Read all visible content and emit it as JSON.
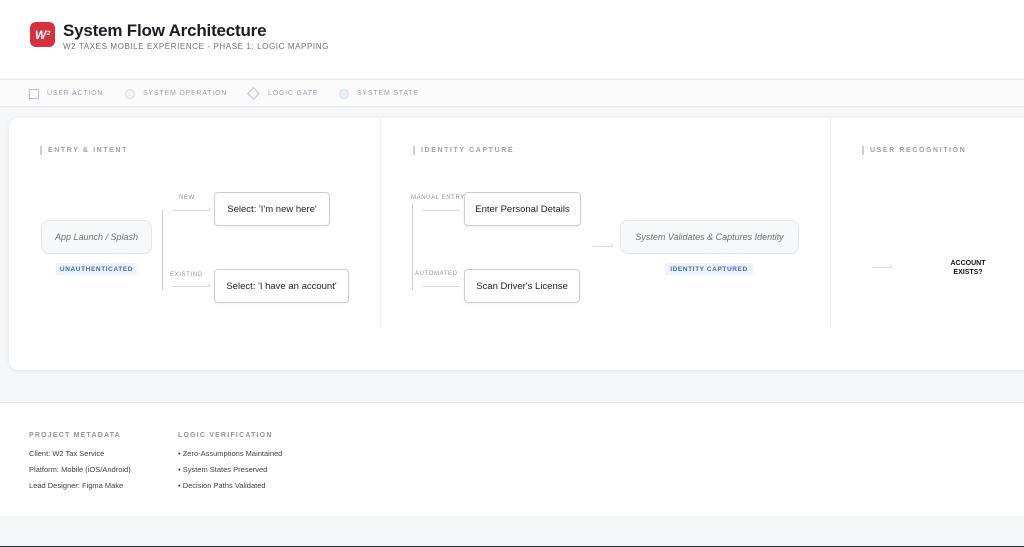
{
  "header": {
    "logo_text": "W²",
    "title": "System Flow Architecture",
    "subtitle": "W2 TAXES MOBILE EXPERIENCE - PHASE 1: LOGIC MAPPING"
  },
  "legend": {
    "user_action": "USER ACTION",
    "system_operation": "SYSTEM OPERATION",
    "logic_gate": "LOGIC GATE",
    "system_state": "SYSTEM STATE"
  },
  "sections": {
    "entry": {
      "title": "ENTRY & INTENT",
      "launch_node": "App Launch / Splash",
      "launch_state": "UNAUTHENTICATED",
      "branch_new_label": "NEW",
      "branch_new_node": "Select: 'I'm new here'",
      "branch_existing_label": "EXISTING",
      "branch_existing_node": "Select: 'I have an account'"
    },
    "identity": {
      "title": "IDENTITY CAPTURE",
      "manual_label": "MANUAL ENTRY",
      "manual_node": "Enter Personal Details",
      "auto_label": "AUTOMATED",
      "auto_node": "Scan Driver's License",
      "validate_node": "System Validates & Captures Identity",
      "validate_state": "IDENTITY CAPTURED"
    },
    "recognition": {
      "title": "USER RECOGNITION",
      "gate_line1": "ACCOUNT",
      "gate_line2": "EXISTS?"
    }
  },
  "footer": {
    "metadata_title": "PROJECT METADATA",
    "metadata": [
      "Client: W2 Tax Service",
      "Platform: Mobile (iOS/Android)",
      "Lead Designer: Figma Make"
    ],
    "verification_title": "LOGIC VERIFICATION",
    "verification": [
      "• Zero-Assumptions Maintained",
      "• System States Preserved",
      "• Decision Paths Validated"
    ]
  },
  "colors": {
    "brand": "#d8313d",
    "state_text": "#3869d4",
    "state_bg": "#eef3fd"
  }
}
